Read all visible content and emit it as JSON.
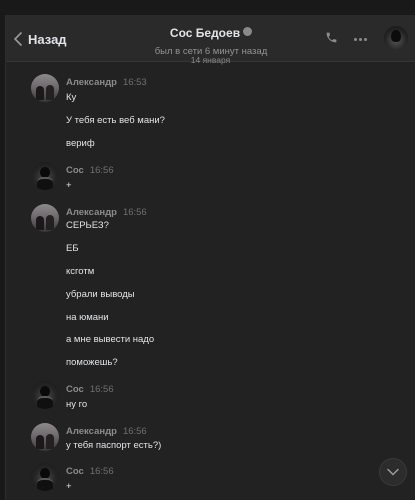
{
  "header": {
    "back_label": "Назад",
    "chat_name": "Сос Бедоев",
    "status": "был в сети 6 минут назад"
  },
  "date_separator": "14 января",
  "messages": [
    {
      "author": "Александр",
      "time": "16:53",
      "texts": [
        "Ку",
        "У тебя есть веб мани?",
        "вериф"
      ]
    },
    {
      "author": "Сос",
      "time": "16:56",
      "texts": [
        "+"
      ]
    },
    {
      "author": "Александр",
      "time": "16:56",
      "texts": [
        "СЕРЬЕЗ?",
        "ЕБ",
        "ксготм",
        "убрали выводы",
        "на юмани",
        "а мне вывести надо",
        "поможешь?"
      ]
    },
    {
      "author": "Сос",
      "time": "16:56",
      "texts": [
        "ну го"
      ]
    },
    {
      "author": "Александр",
      "time": "16:56",
      "texts": [
        "у тебя паспорт есть?)"
      ]
    },
    {
      "author": "Сос",
      "time": "16:56",
      "texts": [
        "+"
      ]
    }
  ]
}
